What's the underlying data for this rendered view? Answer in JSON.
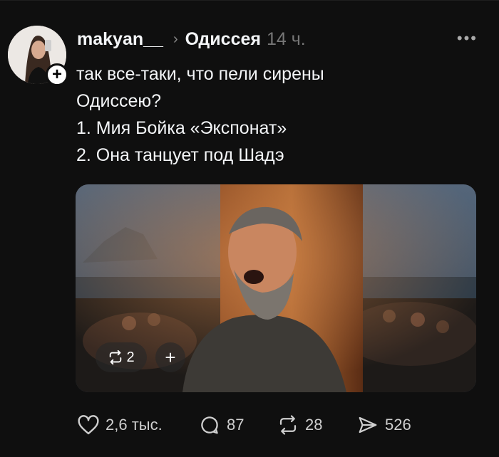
{
  "post": {
    "username": "makyan__",
    "separator": "›",
    "community": "Одиссея",
    "time": "14 ч.",
    "more": "•••",
    "text_lines": [
      "так все-таки, что пели сирены",
      "Одиссею?",
      "1. Мия Бойка «Экспонат»",
      "2. Она танцует под Шадэ"
    ]
  },
  "media": {
    "repost_count": "2",
    "add_label": "+"
  },
  "actions": {
    "likes": "2,6 тыс.",
    "replies": "87",
    "reposts": "28",
    "shares": "526"
  },
  "icons": {
    "follow": "plus-icon",
    "like": "heart-icon",
    "reply": "comment-bubble-icon",
    "repost": "repost-icon",
    "share": "send-icon",
    "more": "more-horizontal-icon"
  },
  "colors": {
    "background": "#0f0f0f",
    "text": "#f3f5f7",
    "muted": "#777777"
  }
}
